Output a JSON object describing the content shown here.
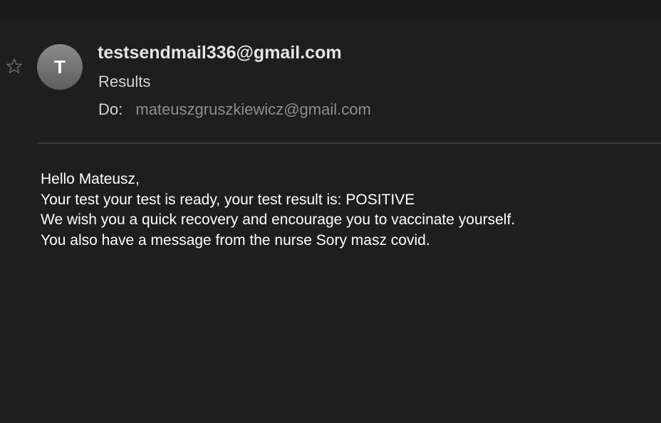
{
  "email": {
    "avatar_initial": "T",
    "from": "testsendmail336@gmail.com",
    "subject": "Results",
    "to_label": "Do:",
    "to_address": "mateuszgruszkiewicz@gmail.com",
    "body_lines": [
      "Hello Mateusz,",
      "Your test your test is ready, your test result is: POSITIVE",
      "We wish you a quick recovery and encourage you to vaccinate yourself.",
      "You also have a message from the nurse Sory masz covid."
    ]
  },
  "icons": {
    "star": "star-outline-icon"
  },
  "colors": {
    "background": "#1e1e1e",
    "avatar": "#707070",
    "sender_text": "#e4e4e4",
    "secondary_text": "#8e8e8e",
    "body_text": "#ffffff"
  }
}
